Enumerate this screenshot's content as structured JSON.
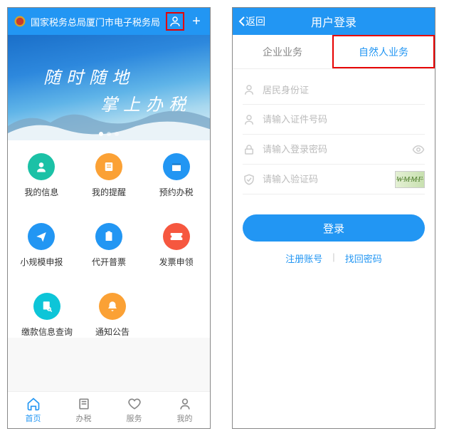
{
  "leftPhone": {
    "headerTitle": "国家税务总局厦门市电子税务局",
    "banner": {
      "line1": "随时随地",
      "line2": "掌上办税"
    },
    "grid": [
      [
        {
          "label": "我的信息",
          "color": "circle-cyan",
          "iconName": "person-badge-icon"
        },
        {
          "label": "我的提醒",
          "color": "circle-orange",
          "iconName": "note-icon"
        },
        {
          "label": "预约办税",
          "color": "circle-blue",
          "iconName": "calendar-icon"
        }
      ],
      [
        {
          "label": "小规模申报",
          "color": "circle-blue",
          "iconName": "paper-plane-icon"
        },
        {
          "label": "代开普票",
          "color": "circle-blue",
          "iconName": "clipboard-icon"
        },
        {
          "label": "发票申领",
          "color": "circle-red",
          "iconName": "ticket-icon"
        }
      ],
      [
        {
          "label": "缴款信息查询",
          "color": "circle-cyan2",
          "iconName": "search-doc-icon"
        },
        {
          "label": "通知公告",
          "color": "circle-orange",
          "iconName": "bell-icon"
        }
      ]
    ],
    "nav": [
      {
        "label": "首页",
        "iconName": "home-icon",
        "active": true
      },
      {
        "label": "办税",
        "iconName": "book-icon",
        "active": false
      },
      {
        "label": "服务",
        "iconName": "heart-icon",
        "active": false
      },
      {
        "label": "我的",
        "iconName": "user-icon",
        "active": false
      }
    ]
  },
  "rightPhone": {
    "back": "返回",
    "title": "用户登录",
    "tabs": {
      "enterprise": "企业业务",
      "individual": "自然人业务"
    },
    "form": {
      "idType": "居民身份证",
      "idPlaceholder": "请输入证件号码",
      "pwdPlaceholder": "请输入登录密码",
      "captchaPlaceholder": "请输入验证码",
      "captchaText": "WMMF"
    },
    "loginBtn": "登录",
    "registerLink": "注册账号",
    "forgotLink": "找回密码"
  }
}
